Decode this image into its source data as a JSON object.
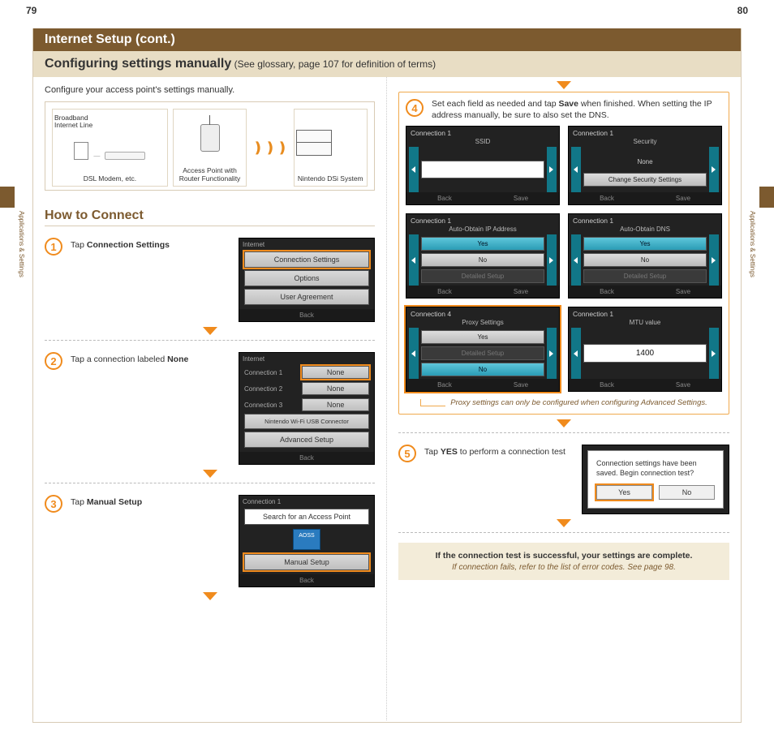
{
  "pageLeft": "79",
  "pageRight": "80",
  "sideCaption": "Applications & Settings",
  "title": "Internet Setup (cont.)",
  "subtitle_bold": "Configuring settings manually",
  "subtitle_rest": " (See glossary, page 107 for definition of terms)",
  "columns": {
    "left": {
      "intro": "Configure your access point's settings manually.",
      "diagram": {
        "broadband_label": "Broadband\nInternet Line",
        "panel1_label": "DSL Modem, etc.",
        "panel2_label": "Access Point with\nRouter Functionality",
        "panel3_label": "Nintendo DSi System"
      },
      "sectionHead": "How to Connect",
      "step1": {
        "num": "1",
        "text_pre": "Tap ",
        "text_bold": "Connection Settings",
        "ss_title": "Internet",
        "btn1": "Connection Settings",
        "btn2": "Options",
        "btn3": "User Agreement",
        "back": "Back"
      },
      "step2": {
        "num": "2",
        "text_pre": "Tap a connection labeled ",
        "text_bold": "None",
        "ss_title": "Internet",
        "rows": [
          {
            "lbl": "Connection 1",
            "val": "None"
          },
          {
            "lbl": "Connection 2",
            "val": "None"
          },
          {
            "lbl": "Connection 3",
            "val": "None"
          }
        ],
        "wifi_btn": "Nintendo Wi-Fi USB Connector",
        "adv_btn": "Advanced Setup",
        "back": "Back"
      },
      "step3": {
        "num": "3",
        "text_pre": "Tap ",
        "text_bold": "Manual Setup",
        "ss_title": "Connection 1",
        "btn1": "Search for an Access Point",
        "aoss": "AOSS",
        "btn3": "Manual Setup",
        "back": "Back"
      }
    },
    "right": {
      "step4": {
        "num": "4",
        "text_pre": "Set each field as needed and tap ",
        "text_bold": "Save",
        "text_post": " when finished.",
        "ital": "When setting the IP address manually, be sure to also set the DNS.",
        "grid": {
          "ssid": {
            "head": "Connection 1",
            "sub": "SSID",
            "back": "Back",
            "save": "Save"
          },
          "sec": {
            "head": "Connection 1",
            "sub": "Security",
            "none": "None",
            "change": "Change Security Settings",
            "back": "Back",
            "save": "Save"
          },
          "ip": {
            "head": "Connection 1",
            "sub": "Auto-Obtain IP Address",
            "yes": "Yes",
            "no": "No",
            "det": "Detailed Setup",
            "back": "Back",
            "save": "Save"
          },
          "dns": {
            "head": "Connection 1",
            "sub": "Auto-Obtain DNS",
            "yes": "Yes",
            "no": "No",
            "det": "Detailed Setup",
            "back": "Back",
            "save": "Save"
          },
          "proxy": {
            "head": "Connection 4",
            "sub": "Proxy Settings",
            "yes": "Yes",
            "det": "Detailed Setup",
            "no": "No",
            "back": "Back",
            "save": "Save"
          },
          "mtu": {
            "head": "Connection 1",
            "sub": "MTU value",
            "val": "1400",
            "back": "Back",
            "save": "Save"
          }
        },
        "proxy_note": "Proxy settings can only be configured when configuring Advanced Settings."
      },
      "step5": {
        "num": "5",
        "text_pre": "Tap ",
        "text_bold": "YES",
        "text_post": " to perform a connection test",
        "dialog_msg": "Connection settings have been saved. Begin connection test?",
        "yes": "Yes",
        "no": "No"
      },
      "final": {
        "bold": "If the connection test is successful, your settings are complete.",
        "ital": "If connection fails, refer to the list of error codes. See page 98."
      }
    }
  }
}
